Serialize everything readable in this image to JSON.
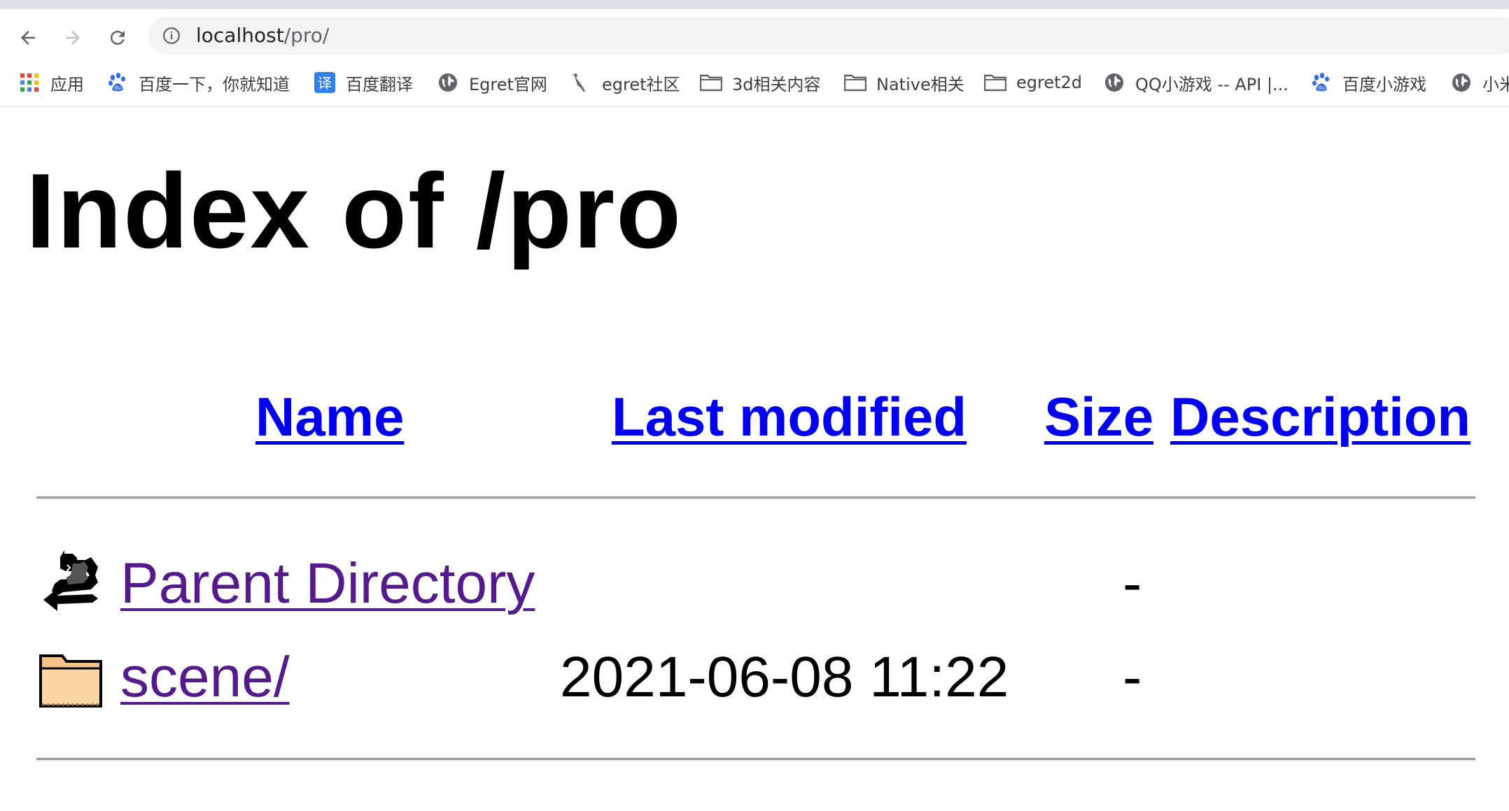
{
  "browser": {
    "address_bar": {
      "host": "localhost",
      "path": "/pro/"
    },
    "nav": {
      "back_icon": "arrow-left-icon",
      "forward_icon": "arrow-right-icon",
      "reload_icon": "reload-icon",
      "info_icon": "info-icon"
    },
    "bookmarks": [
      {
        "label": "应用",
        "icon": "apps-grid-icon"
      },
      {
        "label": "百度一下，你就知道",
        "icon": "baidu-paw-icon"
      },
      {
        "label": "百度翻译",
        "icon": "translate-icon"
      },
      {
        "label": "Egret官网",
        "icon": "globe-icon"
      },
      {
        "label": "egret社区",
        "icon": "bird-icon"
      },
      {
        "label": "3d相关内容",
        "icon": "folder-icon"
      },
      {
        "label": "Native相关",
        "icon": "folder-icon"
      },
      {
        "label": "egret2d",
        "icon": "folder-icon"
      },
      {
        "label": "QQ小游戏 -- API |...",
        "icon": "globe-icon"
      },
      {
        "label": "百度小游戏",
        "icon": "baidu-paw-icon"
      },
      {
        "label": "小米",
        "icon": "globe-icon"
      }
    ]
  },
  "page": {
    "title": "Index of /pro",
    "columns": {
      "name": "Name",
      "last_modified": "Last modified",
      "size": "Size",
      "description": "Description"
    },
    "rows": [
      {
        "name": "Parent Directory",
        "last_modified": "",
        "size": "-",
        "description": "",
        "icon": "back-arrow-icon"
      },
      {
        "name": "scene/",
        "last_modified": "2021-06-08 11:22",
        "size": "-",
        "description": "",
        "icon": "folder-icon"
      }
    ]
  }
}
